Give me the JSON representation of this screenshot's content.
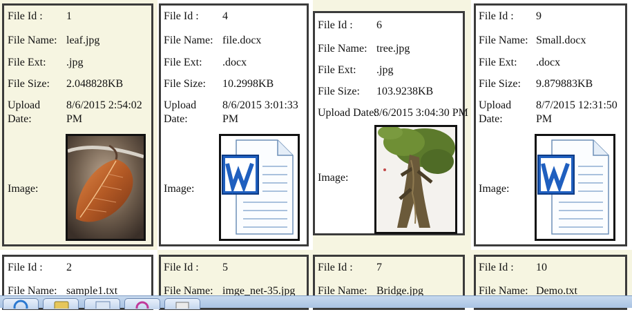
{
  "labels": {
    "file_id": "File Id :",
    "file_name": "File Name:",
    "file_ext": "File Ext:",
    "file_size": "File Size:",
    "upload_date_line1": "Upload",
    "upload_date_line2": "Date:",
    "upload_date_single": "Upload Date:",
    "image": "Image:"
  },
  "cards": [
    {
      "id": "1",
      "name": "leaf.jpg",
      "ext": ".jpg",
      "size": "2.048828KB",
      "date_line1": "8/6/2015 2:54:02",
      "date_line2": "PM",
      "thumbnail": "leaf-photo"
    },
    {
      "id": "4",
      "name": "file.docx",
      "ext": ".docx",
      "size": "10.2998KB",
      "date_line1": "8/6/2015 3:01:33",
      "date_line2": "PM",
      "thumbnail": "word-document-icon"
    },
    {
      "id": "6",
      "name": "tree.jpg",
      "ext": ".jpg",
      "size": "103.9238KB",
      "date": "8/6/2015 3:04:30 PM",
      "thumbnail": "tree-photo"
    },
    {
      "id": "9",
      "name": "Small.docx",
      "ext": ".docx",
      "size": "9.879883KB",
      "date_line1": "8/7/2015 12:31:50",
      "date_line2": "PM",
      "thumbnail": "word-document-icon"
    },
    {
      "id": "2",
      "name": "sample1.txt"
    },
    {
      "id": "5",
      "name": "imge_net-35.jpg"
    },
    {
      "id": "7",
      "name": "Bridge.jpg"
    },
    {
      "id": "10",
      "name": "Demo.txt"
    }
  ],
  "colors": {
    "alt_cell_bg": "#f6f5e1",
    "card_border": "#3b3b3b",
    "word_blue": "#1f5fbf",
    "taskbar": "#b7cde9"
  }
}
